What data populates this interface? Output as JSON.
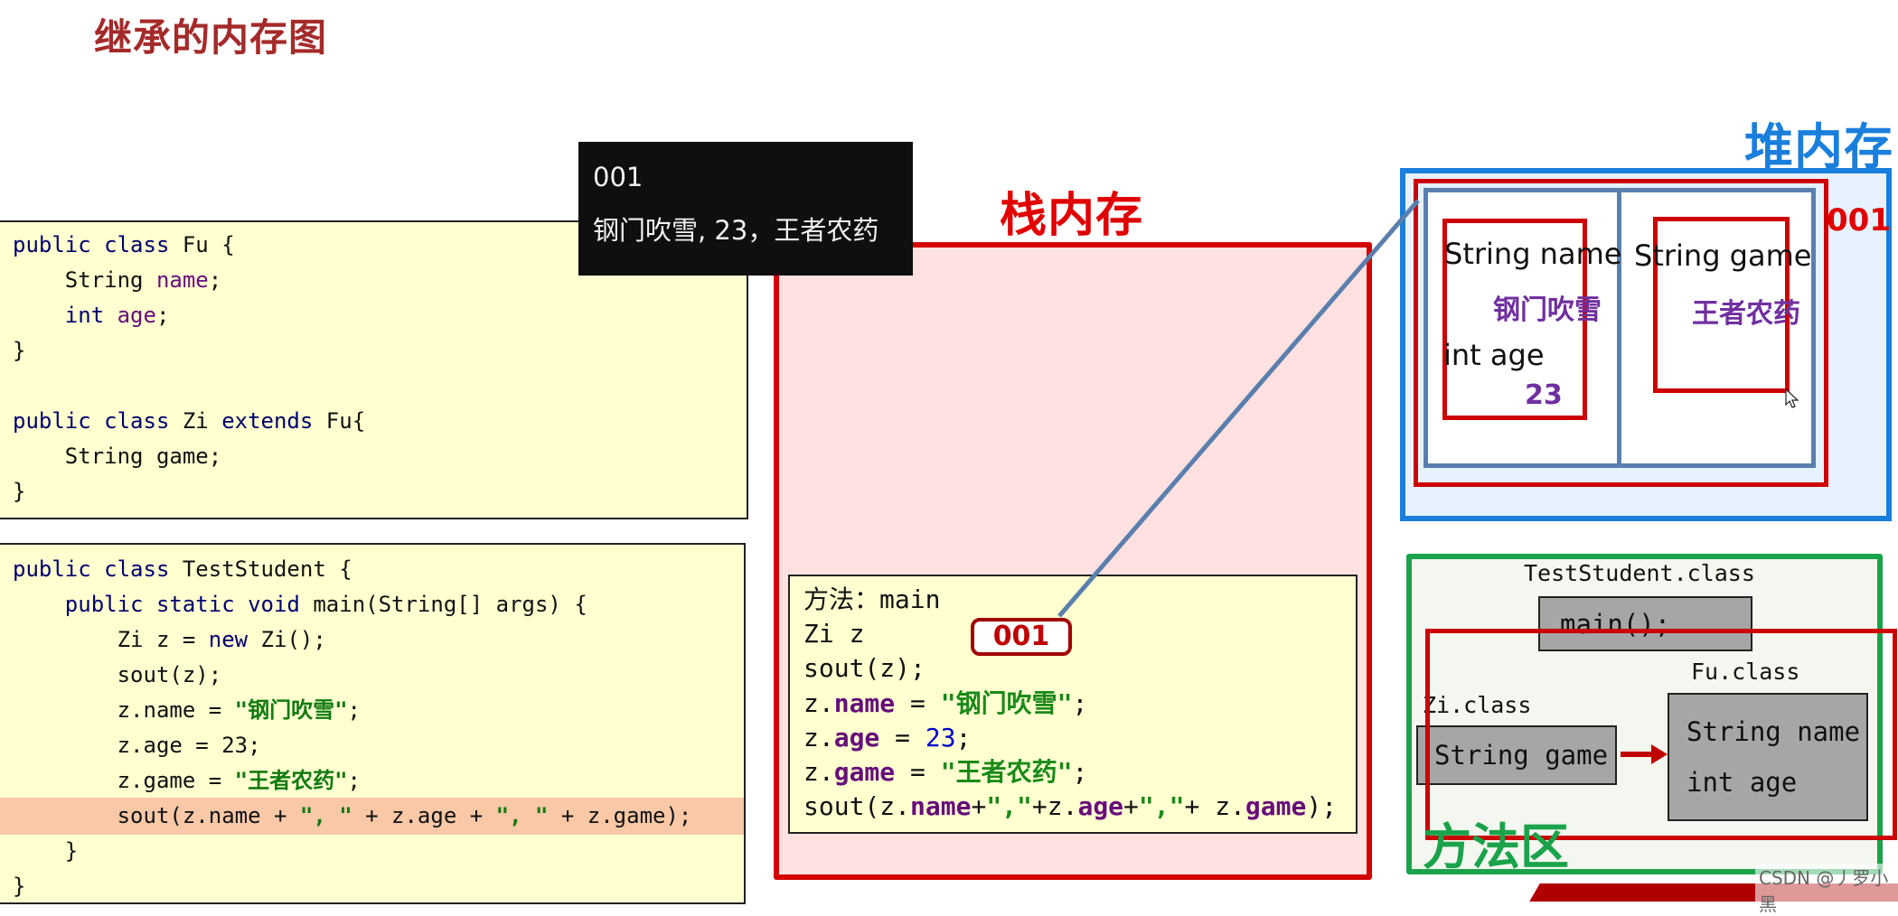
{
  "title": "继承的内存图",
  "code_fu_zi": {
    "lines": [
      [
        "public class",
        " Fu {"
      ],
      [
        "    String ",
        "name",
        ";"
      ],
      [
        "    int ",
        "age",
        ";"
      ],
      [
        "}"
      ],
      [
        ""
      ],
      [
        "public class",
        " Zi ",
        "extends",
        " Fu{"
      ],
      [
        "    String game;"
      ],
      [
        "}"
      ]
    ]
  },
  "code_test": {
    "line1_kw": "public class",
    "line1_rest": " TestStudent {",
    "line2_kw": "    public static void",
    "line2_rest": " main(String[] args) {",
    "line3_a": "        Zi z = ",
    "line3_kw": "new",
    "line3_b": " Zi();",
    "line4": "        sout(z);",
    "line5_a": "        z.name = ",
    "line5_str": "\"钢门吹雪\"",
    "line5_b": ";",
    "line6": "        z.age = 23;",
    "line7_a": "        z.game = ",
    "line7_str": "\"王者农药\"",
    "line7_b": ";",
    "line8_a": "        sout(z.name + ",
    "line8_s1": "\", \"",
    "line8_b": " + z.age + ",
    "line8_s2": "\", \"",
    "line8_c": " + z.game);",
    "line9": "    }",
    "line10": "}",
    "highlighted_line": 8
  },
  "tooltip": {
    "line1": "001",
    "line2": "钢门吹雪, 23，王者农药"
  },
  "stack": {
    "label": "栈内存",
    "frame": {
      "method_prefix": "方法：",
      "method_name": "main",
      "var_decl": "Zi z",
      "ref_value": "001",
      "line_sout": "sout(z);",
      "name_a": "z.",
      "name_f": "name",
      "name_b": " = ",
      "name_s": "\"钢门吹雪\"",
      "name_c": ";",
      "age_a": "z.",
      "age_f": "age",
      "age_b": " = ",
      "age_n": "23",
      "age_c": ";",
      "game_a": "z.",
      "game_f": "game",
      "game_b": " = ",
      "game_s": "\"王者农药\"",
      "game_c": ";",
      "out_a": "sout(z.",
      "out_f1": "name",
      "out_p1": "+",
      "out_s1": "\",\"",
      "out_p2": "+z.",
      "out_f2": "age",
      "out_p3": "+",
      "out_s2": "\",\"",
      "out_p4": "+ z.",
      "out_f3": "game",
      "out_end": ");"
    }
  },
  "heap": {
    "label": "堆内存",
    "address": "001",
    "parent_part": {
      "field1": "String name",
      "value1": "钢门吹雪",
      "field2": "int age",
      "value2": "23"
    },
    "child_part": {
      "field1": "String game",
      "value1": "王者农药"
    }
  },
  "method_area": {
    "label": "方法区",
    "test_class": "TestStudent.class",
    "test_method": "main();",
    "zi_class": "Zi.class",
    "zi_field": "String game",
    "fu_class": "Fu.class",
    "fu_field1": "String name",
    "fu_field2": "int age"
  },
  "watermark": "CSDN @丿罗小黑",
  "colors": {
    "title": "#a52a2a",
    "stack": "#d40000",
    "heap": "#1a7fdc",
    "method_area": "#1aa34a",
    "value_purple": "#7030a0",
    "reference_line": "#5a7fad"
  }
}
